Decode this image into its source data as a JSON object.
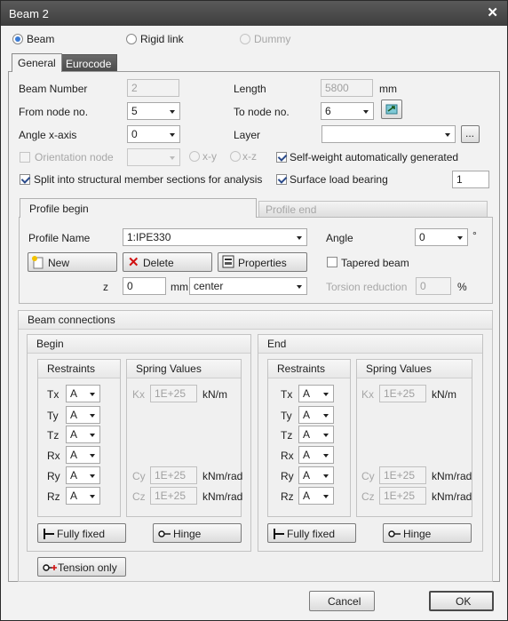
{
  "window": {
    "title": "Beam 2"
  },
  "type_options": {
    "beam": "Beam",
    "rigid_link": "Rigid link",
    "dummy": "Dummy"
  },
  "tabs": {
    "general": "General",
    "eurocode": "Eurocode"
  },
  "general": {
    "beam_number_label": "Beam Number",
    "beam_number_value": "2",
    "length_label": "Length",
    "length_value": "5800",
    "length_unit": "mm",
    "from_node_label": "From node no.",
    "from_node_value": "5",
    "to_node_label": "To node no.",
    "to_node_value": "6",
    "angle_x_label": "Angle x-axis",
    "angle_x_value": "0",
    "layer_label": "Layer",
    "layer_value": "",
    "layer_browse": "...",
    "orientation_node_label": "Orientation node",
    "xy_label": "x-y",
    "xz_label": "x-z",
    "self_weight_label": "Self-weight automatically generated",
    "split_label": "Split into structural member sections for analysis",
    "surface_load_label": "Surface load bearing",
    "surface_load_value": "1"
  },
  "profile_tabs": {
    "begin": "Profile begin",
    "end": "Profile end"
  },
  "profile": {
    "name_label": "Profile Name",
    "name_value": "1:IPE330",
    "angle_label": "Angle",
    "angle_value": "0",
    "angle_unit": "°",
    "new_label": "New",
    "delete_label": "Delete",
    "properties_label": "Properties",
    "tapered_label": "Tapered beam",
    "z_label": "z",
    "z_value": "0",
    "z_unit": "mm",
    "z_align": "center",
    "torsion_label": "Torsion reduction",
    "torsion_value": "0",
    "torsion_unit": "%"
  },
  "connections": {
    "title": "Beam connections",
    "restraints_label": "Restraints",
    "spring_label": "Spring Values",
    "dofs": [
      "Tx",
      "Ty",
      "Tz",
      "Rx",
      "Ry",
      "Rz"
    ],
    "spring_value": "1E+25",
    "kx": "Kx",
    "cy": "Cy",
    "cz": "Cz",
    "kn_m": "kN/m",
    "knm_rad": "kNm/rad",
    "fully_fixed": "Fully fixed",
    "hinge": "Hinge",
    "tension_only": "Tension only",
    "begin": {
      "title": "Begin",
      "values": [
        "A",
        "A",
        "A",
        "A",
        "A",
        "A"
      ]
    },
    "end": {
      "title": "End",
      "values": [
        "A",
        "A",
        "A",
        "A",
        "A",
        "A"
      ]
    }
  },
  "footer": {
    "cancel": "Cancel",
    "ok": "OK"
  }
}
